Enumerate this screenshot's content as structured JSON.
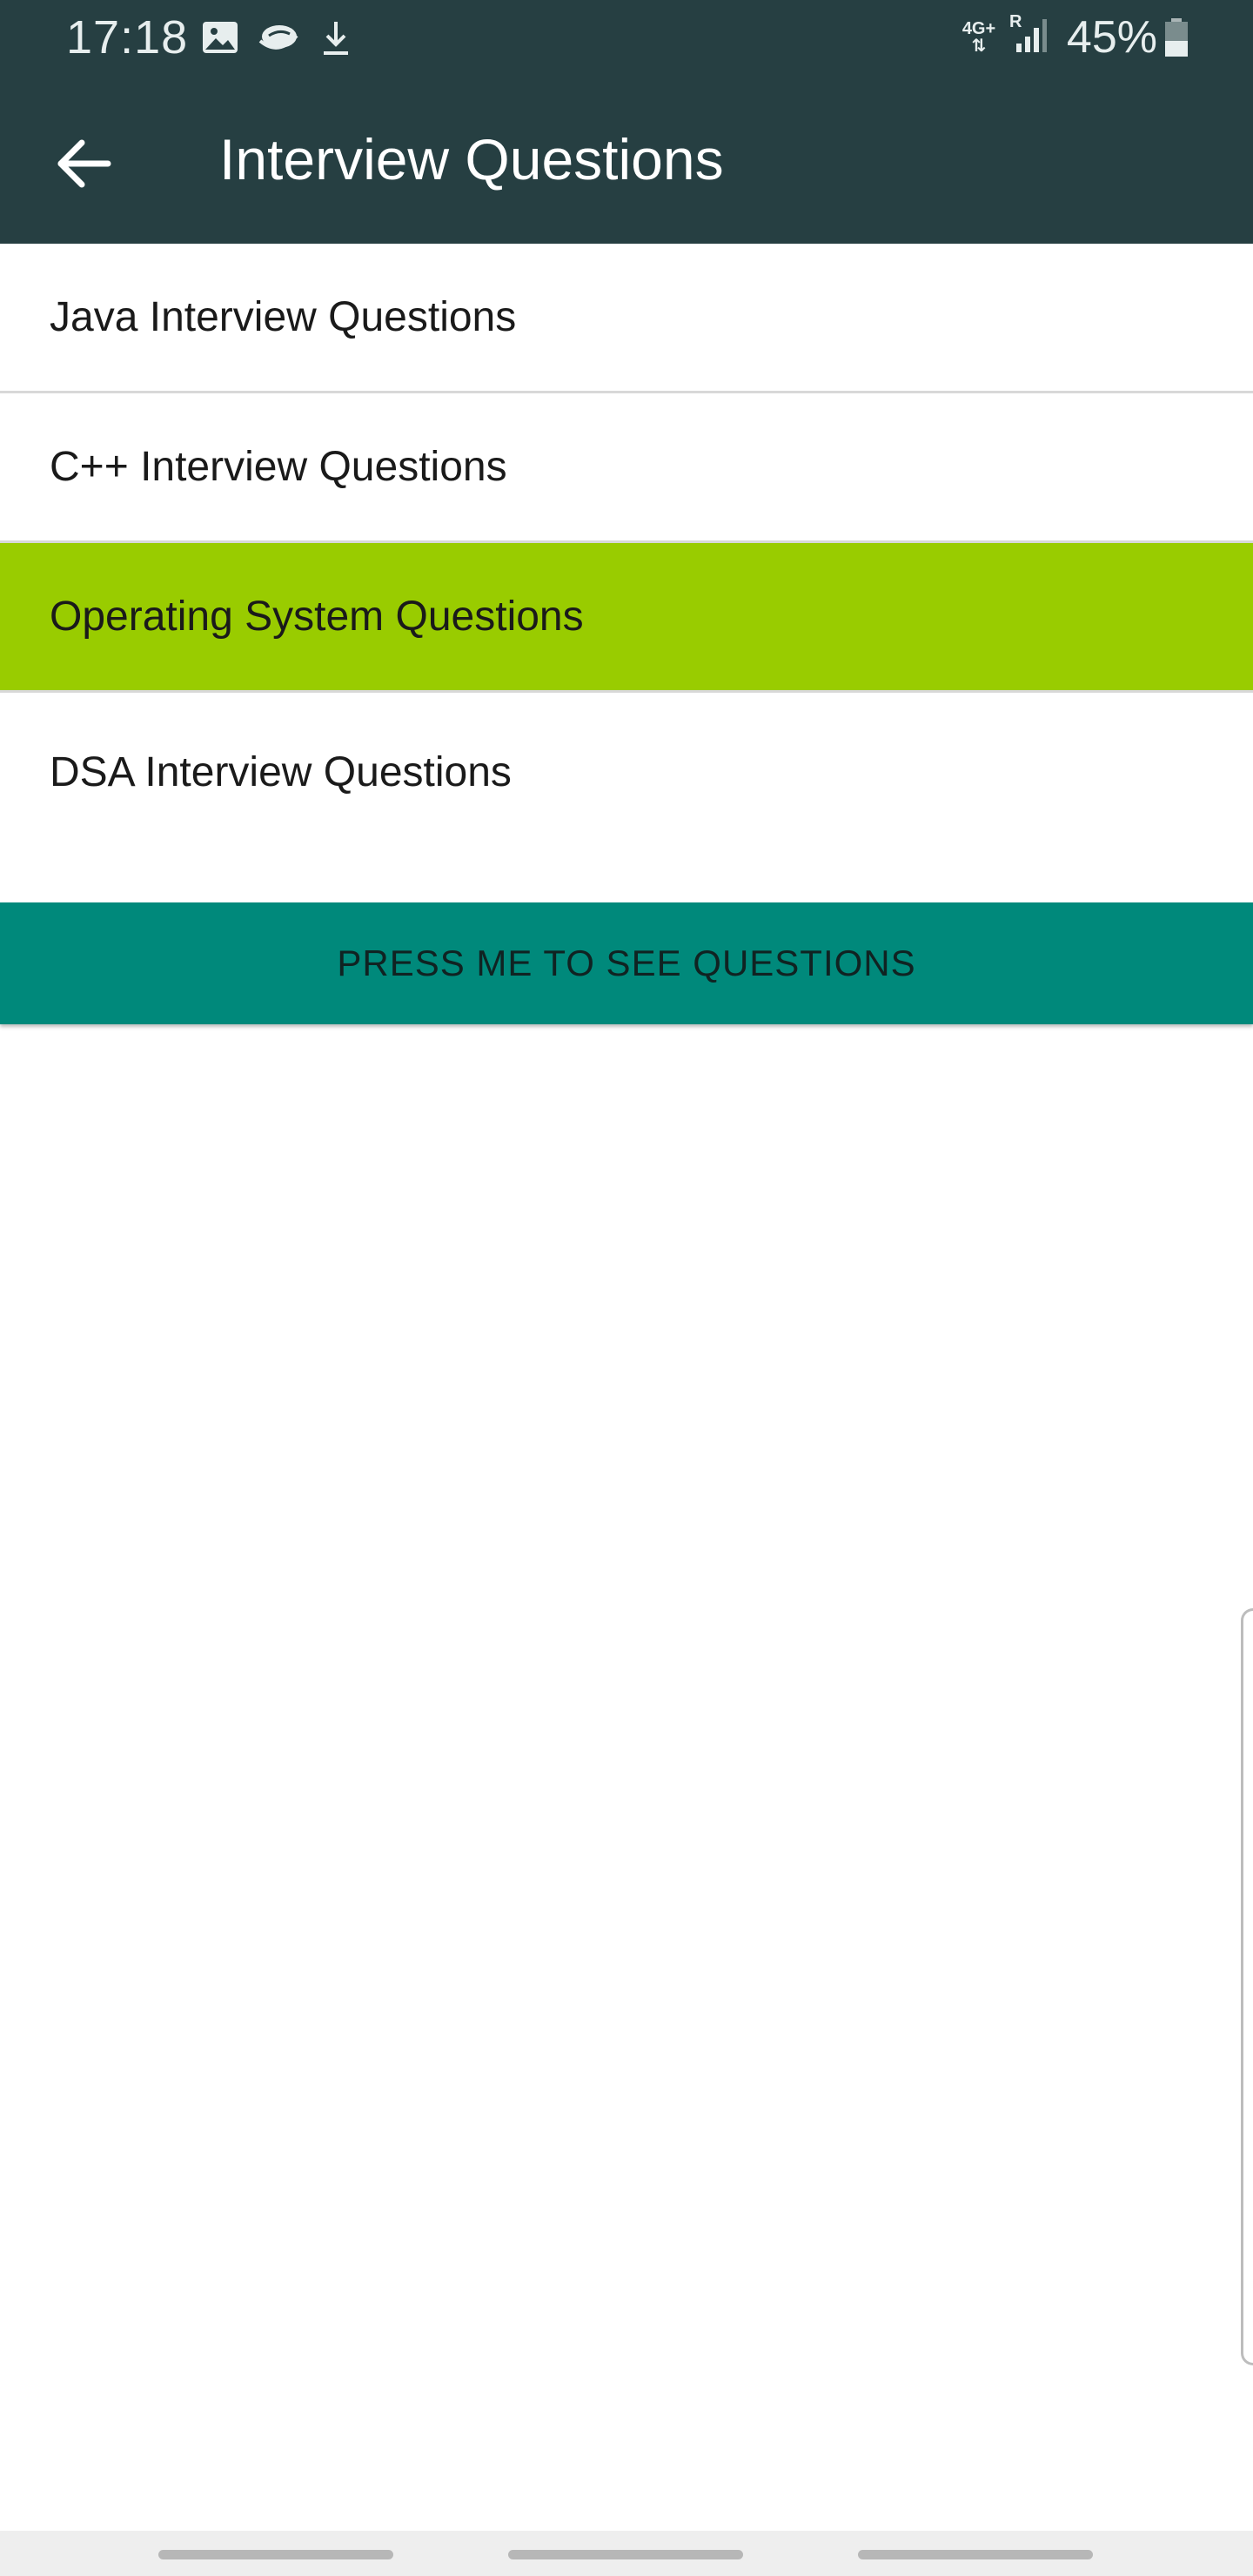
{
  "status_bar": {
    "time": "17:18",
    "left_icons": [
      "image-icon",
      "cloud-icon",
      "download-icon"
    ],
    "network_label": "4G+",
    "roaming_label": "R",
    "battery_percent": "45%",
    "battery_level": 0.45
  },
  "app_bar": {
    "title": "Interview Questions",
    "back_icon": "arrow-left-icon"
  },
  "list": {
    "items": [
      {
        "label": "Java Interview Questions",
        "selected": false
      },
      {
        "label": "C++ Interview Questions",
        "selected": false
      },
      {
        "label": "Operating System Questions",
        "selected": true
      },
      {
        "label": "DSA Interview Questions",
        "selected": false
      }
    ]
  },
  "action_button": {
    "label": "PRESS ME TO SEE QUESTIONS"
  },
  "colors": {
    "app_bar": "#263f42",
    "selected_item": "#99cc00",
    "button": "#00897b",
    "background": "#ffffff"
  }
}
